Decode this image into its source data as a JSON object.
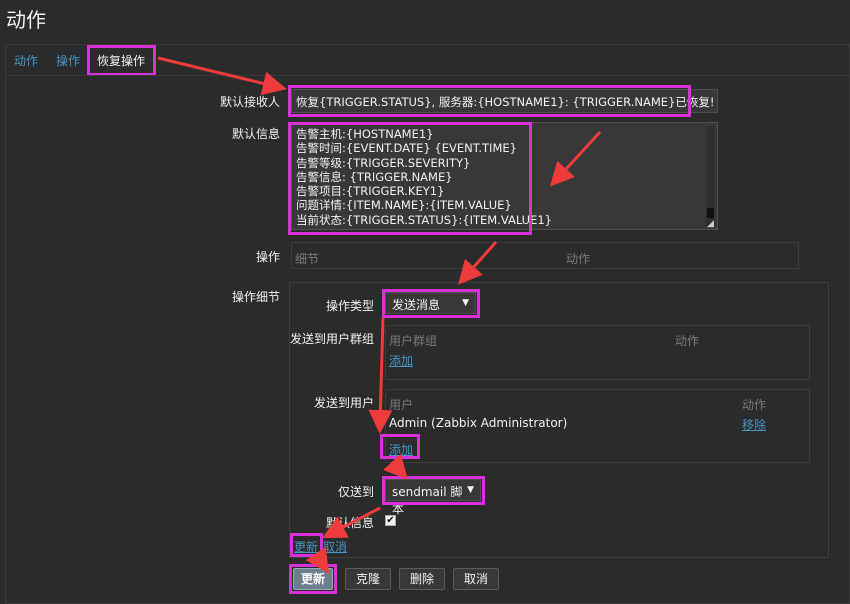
{
  "page": {
    "title": "动作"
  },
  "tabs": [
    {
      "label": "动作"
    },
    {
      "label": "操作"
    },
    {
      "label": "恢复操作"
    }
  ],
  "form": {
    "subject_label": "默认接收人",
    "subject_value": "恢复{TRIGGER.STATUS}, 服务器:{HOSTNAME1}: {TRIGGER.NAME}已恢复!",
    "message_label": "默认信息",
    "message_lines": [
      "告警主机:{HOSTNAME1}",
      "告警时间:{EVENT.DATE} {EVENT.TIME}",
      "告警等级:{TRIGGER.SEVERITY}",
      "告警信息: {TRIGGER.NAME}",
      "告警项目:{TRIGGER.KEY1}",
      "问题详情:{ITEM.NAME}:{ITEM.VALUE}",
      "当前状态:{TRIGGER.STATUS}:{ITEM.VALUE1}"
    ],
    "operations_label": "操作",
    "operations_col_details": "细节",
    "operations_col_action": "动作",
    "op_details_label": "操作细节",
    "op_type_label": "操作类型",
    "op_type_value": "发送消息",
    "send_to_groups_label": "发送到用户群组",
    "groups_col_group": "用户群组",
    "groups_col_action": "动作",
    "groups_add": "添加",
    "send_to_users_label": "发送到用户",
    "users_col_user": "用户",
    "users_col_action": "动作",
    "users_rows": [
      {
        "name": "Admin (Zabbix Administrator)",
        "action": "移除"
      }
    ],
    "users_add": "添加",
    "send_only_to_label": "仅送到",
    "send_only_to_value": "sendmail 脚本",
    "default_message_label": "默认信息",
    "default_message_checked": "✔",
    "inner_update": "更新",
    "inner_cancel": "取消"
  },
  "buttons": {
    "update": "更新",
    "clone": "克隆",
    "delete": "删除",
    "cancel": "取消"
  },
  "icons": {
    "caret": "▼",
    "resize": "◢"
  },
  "colors": {
    "highlight": "#d930d9",
    "arrow": "#ee3b3b",
    "link": "#4796c4"
  }
}
